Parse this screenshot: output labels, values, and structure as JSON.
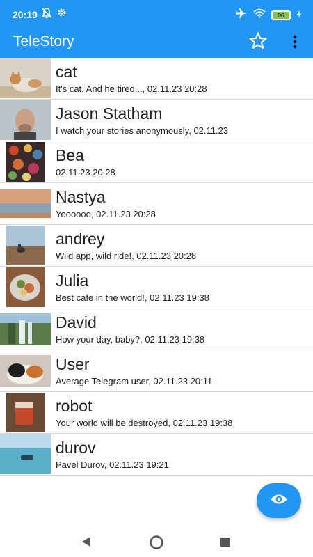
{
  "status_bar": {
    "time": "20:19",
    "battery": "96",
    "left_icons": [
      "notifications-off-icon",
      "settings-icon"
    ],
    "right_icons": [
      "airplane-icon",
      "wifi-icon",
      "battery-icon",
      "charging-icon"
    ]
  },
  "app_bar": {
    "title": "TeleStory",
    "actions": [
      "star-icon",
      "more-vert-icon"
    ]
  },
  "contacts": [
    {
      "name": "cat",
      "subtitle": "It's cat. And he tired..., 02.11.23 20:28"
    },
    {
      "name": "Jason Statham",
      "subtitle": "I watch your stories anonymously, 02.11.23"
    },
    {
      "name": "Bea",
      "subtitle": "02.11.23 20:28"
    },
    {
      "name": "Nastya",
      "subtitle": "Yoooooo, 02.11.23 20:28"
    },
    {
      "name": "andrey",
      "subtitle": "Wild app, wild ride!, 02.11.23 20:28"
    },
    {
      "name": "Julia",
      "subtitle": "Best cafe in the world!, 02.11.23 19:38"
    },
    {
      "name": "David",
      "subtitle": "How your day, baby?, 02.11.23 19:38"
    },
    {
      "name": "User",
      "subtitle": "Average Telegram user, 02.11.23 20:11"
    },
    {
      "name": "robot",
      "subtitle": "Your world will be destroyed, 02.11.23 19:38"
    },
    {
      "name": "durov",
      "subtitle": "Pavel Durov, 02.11.23 19:21"
    }
  ],
  "fab": {
    "icon": "eye-icon"
  },
  "nav_bar": {
    "icons": [
      "back-icon",
      "home-icon",
      "recents-icon"
    ]
  },
  "colors": {
    "primary": "#2196F3",
    "divider": "#d6d6d6",
    "text": "#202020"
  }
}
